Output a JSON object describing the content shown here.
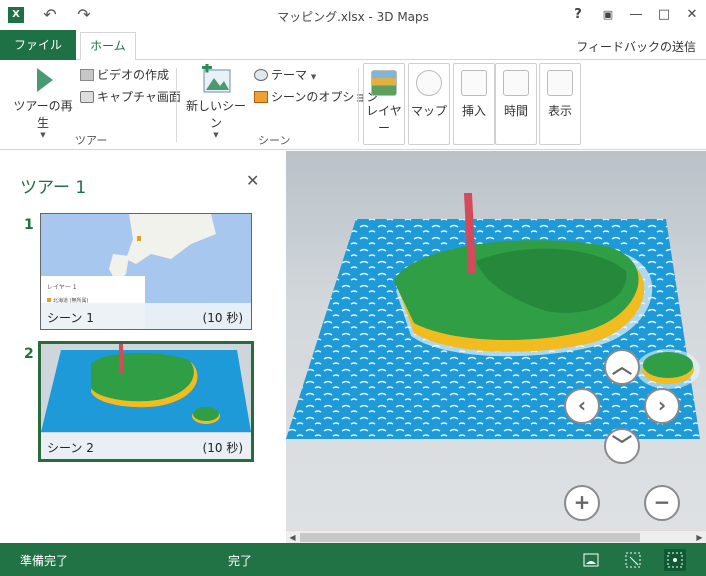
{
  "window": {
    "app_icon": "excel-icon",
    "title": "マッピング.xlsx - 3D Maps",
    "help": "?",
    "minimize": "—",
    "restore": "□",
    "close": "✕"
  },
  "ribbon": {
    "tabs": {
      "file": "ファイル",
      "home": "ホーム"
    },
    "feedback": "フィードバックの送信",
    "tour_group": {
      "play_label": "ツアーの再生",
      "create_video": "ビデオの作成",
      "capture_screen": "キャプチャ画面",
      "label": "ツアー"
    },
    "scene_group": {
      "new_scene": "新しいシーン",
      "theme": "テーマ",
      "scene_options": "シーンのオプション",
      "label": "シーン"
    },
    "tiles": {
      "layer": "レイヤー",
      "map": "マップ",
      "insert": "挿入",
      "time": "時間",
      "view": "表示"
    }
  },
  "tour": {
    "title": "ツアー 1",
    "scenes": [
      {
        "number": "1",
        "name": "シーン 1",
        "duration": "(10 秒)",
        "legend_title": "レイヤー 1",
        "legend_item": "北海道 (無所属)"
      },
      {
        "number": "2",
        "name": "シーン 2",
        "duration": "(10 秒)"
      }
    ]
  },
  "status": {
    "ready": "準備完了",
    "done": "完了"
  },
  "colors": {
    "excel_green": "#217346",
    "sea": "#1e9ad8",
    "land": "#2f9e45",
    "beach": "#f2bb1f",
    "column": "#d44a5a"
  }
}
